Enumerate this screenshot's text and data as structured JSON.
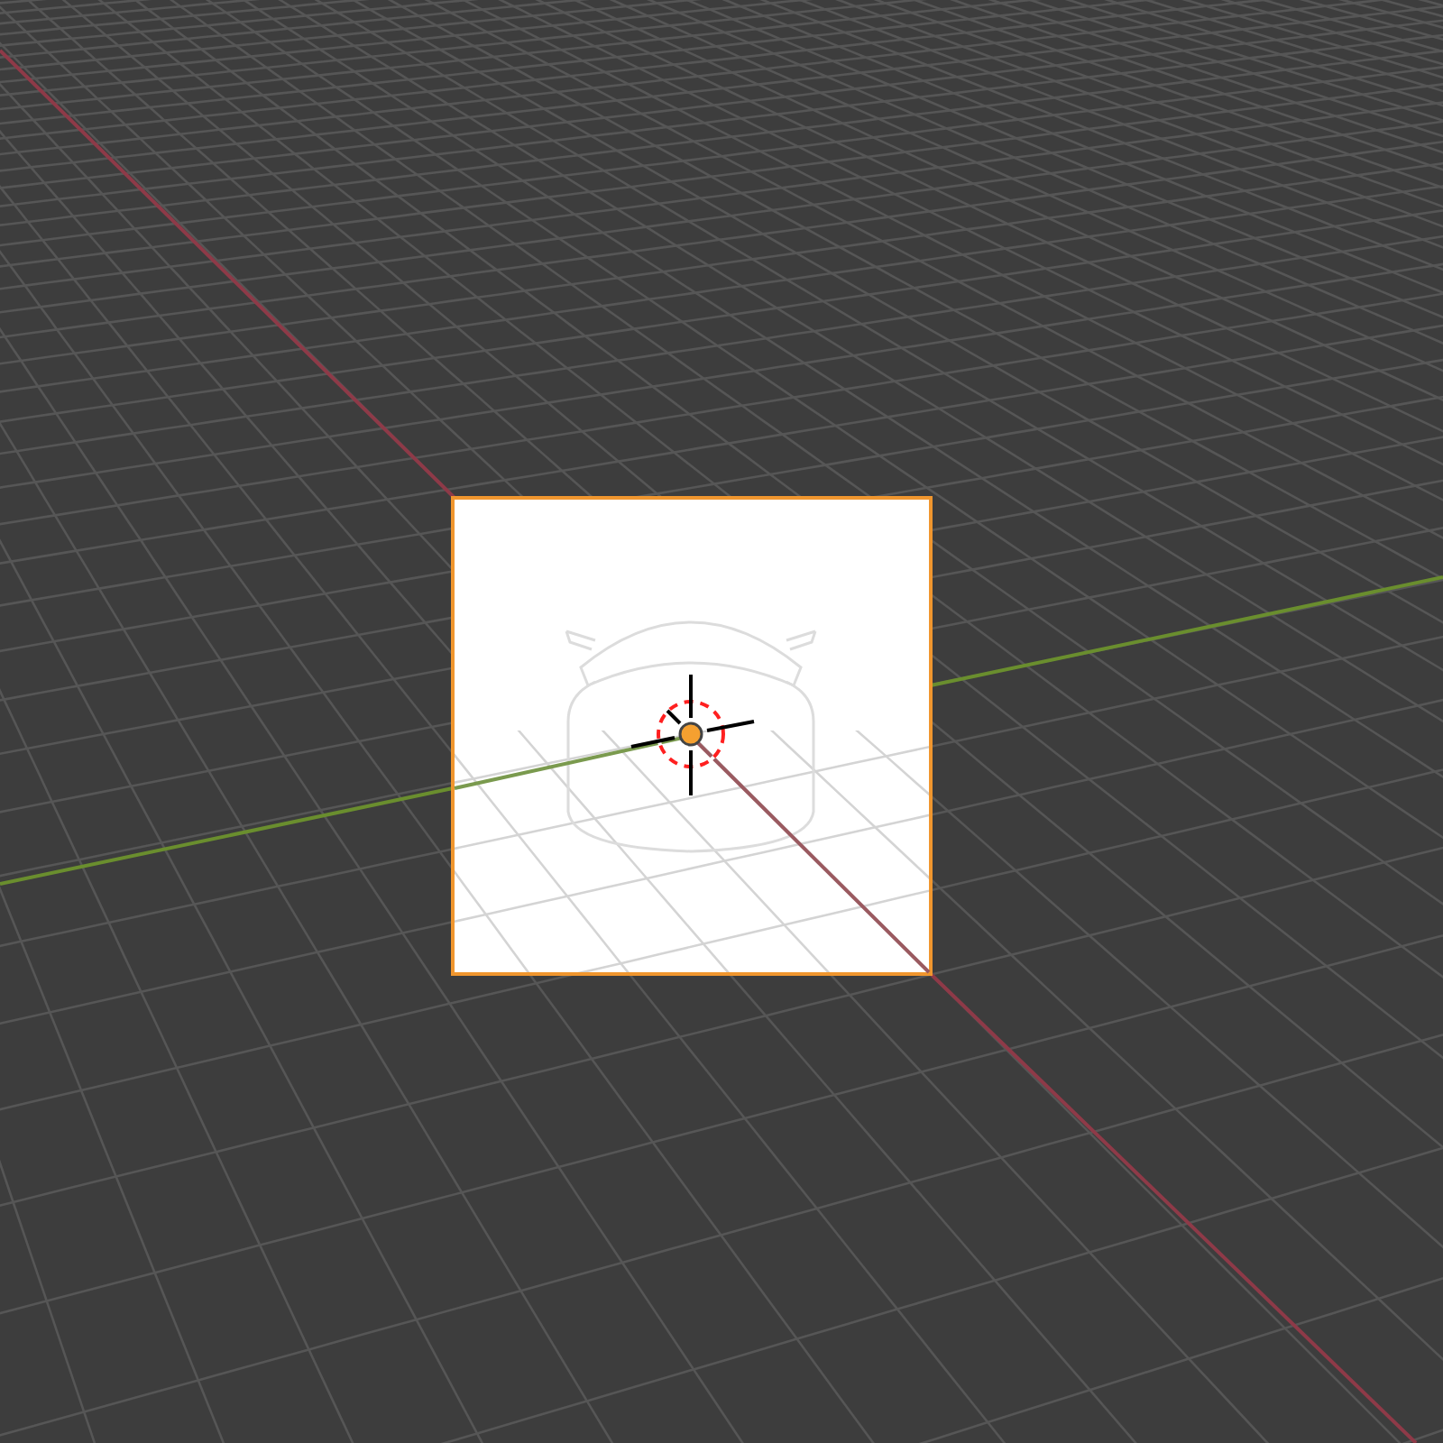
{
  "viewport": {
    "image_plane": {
      "selected": true
    },
    "cursor_3d": {
      "shown": true
    }
  }
}
